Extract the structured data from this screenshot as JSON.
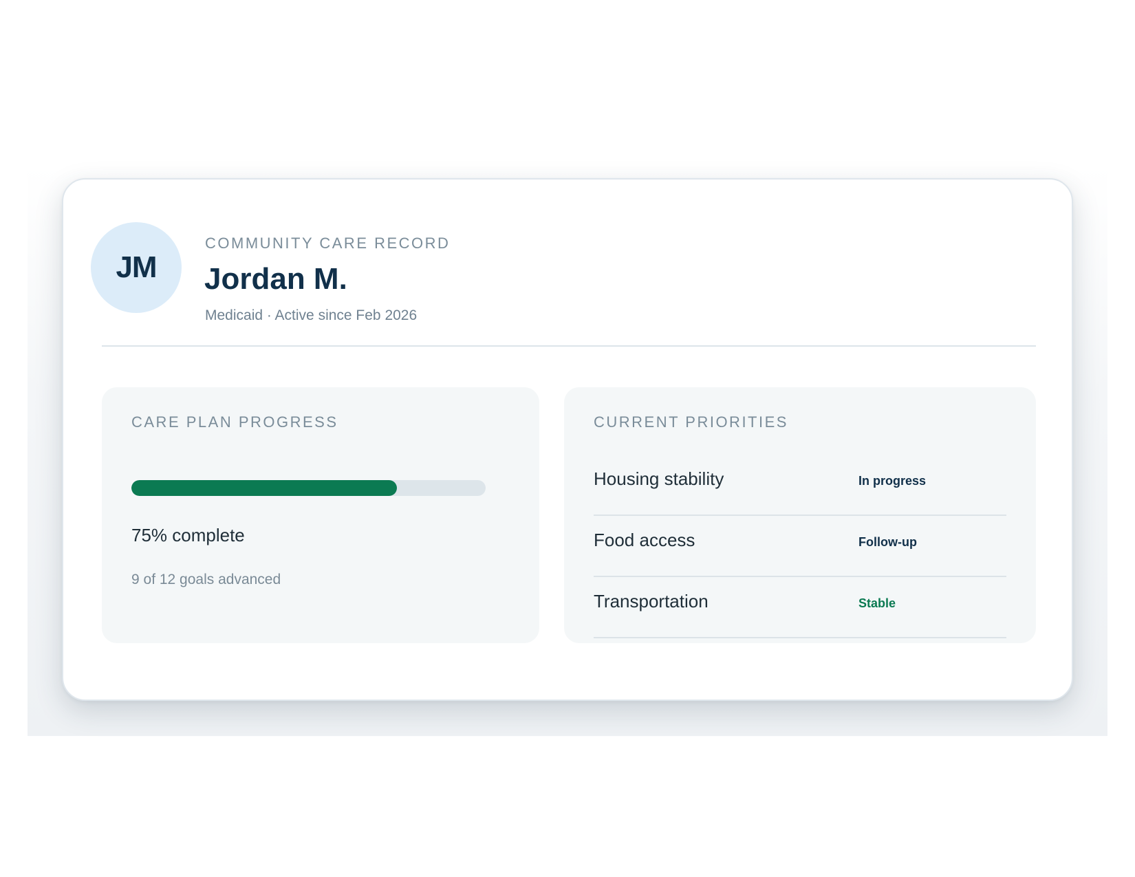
{
  "header": {
    "initials": "JM",
    "eyebrow": "COMMUNITY CARE RECORD",
    "name": "Jordan M.",
    "meta": "Medicaid · Active since Feb 2026"
  },
  "progress": {
    "title": "CARE PLAN PROGRESS",
    "percent": 75,
    "percent_label": "75% complete",
    "goals_label": "9 of 12 goals advanced",
    "fill_color": "#0b7a52",
    "track_color": "#dde5ea"
  },
  "priorities": {
    "title": "CURRENT PRIORITIES",
    "items": [
      {
        "label": "Housing stability",
        "status": "In progress",
        "status_color": "#11304a"
      },
      {
        "label": "Food access",
        "status": "Follow-up",
        "status_color": "#11304a"
      },
      {
        "label": "Transportation",
        "status": "Stable",
        "status_color": "#0b7a52"
      }
    ]
  },
  "colors": {
    "avatar_bg": "#dcecf9",
    "primary_text": "#11304a",
    "accent_green": "#0b7a52"
  }
}
